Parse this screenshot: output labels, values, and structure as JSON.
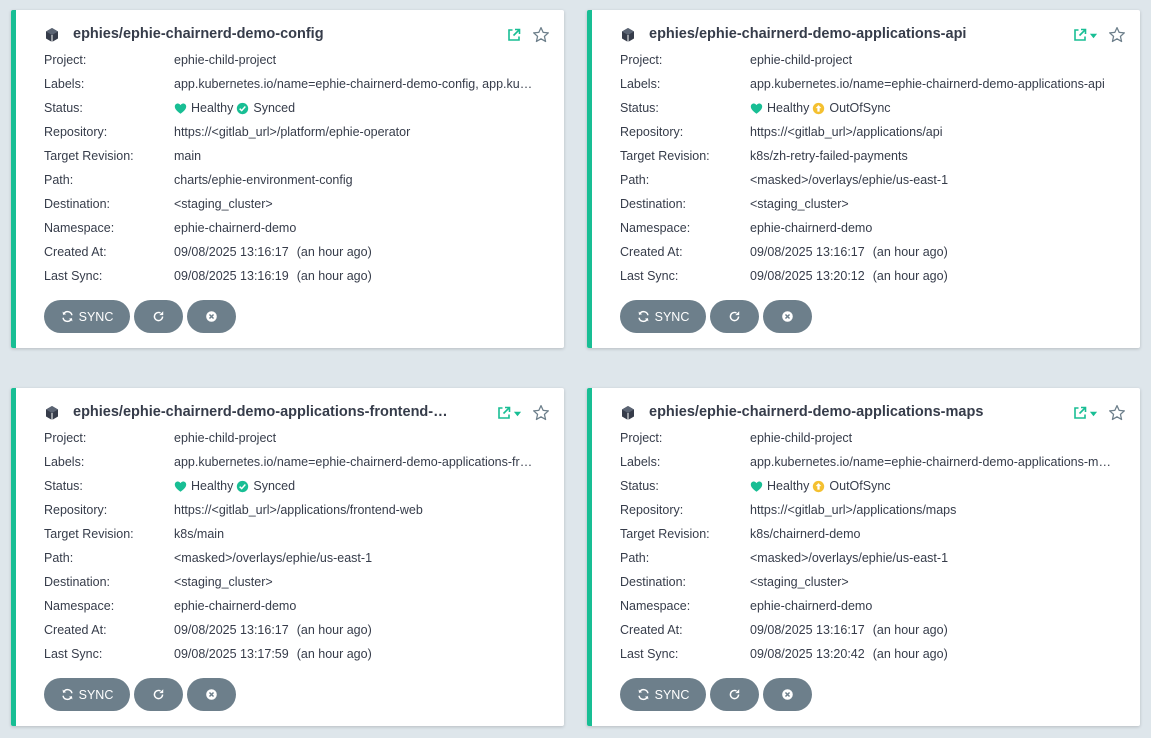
{
  "labels": {
    "project": "Project:",
    "labels": "Labels:",
    "status": "Status:",
    "repository": "Repository:",
    "target_revision": "Target Revision:",
    "path": "Path:",
    "destination": "Destination:",
    "namespace": "Namespace:",
    "created_at": "Created At:",
    "last_sync": "Last Sync:"
  },
  "buttons": {
    "sync_label": "SYNC"
  },
  "colors": {
    "healthy": "#18be94",
    "synced": "#18be94",
    "out_of_sync": "#f4c030",
    "card_border": "#18be94",
    "button_bg": "#6d7f8b"
  },
  "icons": {
    "app": "cube-icon",
    "external_link": "external-link-icon",
    "favorite": "star-icon",
    "healthy": "heart-icon",
    "synced": "check-circle-icon",
    "out_of_sync": "arrow-up-circle-icon",
    "sync": "sync-icon",
    "refresh": "redo-icon",
    "delete": "times-circle-icon"
  },
  "apps": [
    {
      "name": "ephies/ephie-chairnerd-demo-config",
      "project": "ephie-child-project",
      "labels": "app.kubernetes.io/name=ephie-chairnerd-demo-config, app.kubernetes.io/part-of=ephie",
      "health": "Healthy",
      "sync_status": "Synced",
      "repository": "https://<gitlab_url>/platform/ephie-operator",
      "target_revision": "main",
      "path": "charts/ephie-environment-config",
      "destination": "<staging_cluster>",
      "namespace": "ephie-chairnerd-demo",
      "created_at": "09/08/2025 13:16:17",
      "created_ago": "(an hour ago)",
      "last_sync": "09/08/2025 13:16:19",
      "last_sync_ago": "(an hour ago)"
    },
    {
      "name": "ephies/ephie-chairnerd-demo-applications-api",
      "project": "ephie-child-project",
      "labels": "app.kubernetes.io/name=ephie-chairnerd-demo-applications-api",
      "health": "Healthy",
      "sync_status": "OutOfSync",
      "repository": "https://<gitlab_url>/applications/api",
      "target_revision": "k8s/zh-retry-failed-payments",
      "path": "<masked>/overlays/ephie/us-east-1",
      "destination": "<staging_cluster>",
      "namespace": "ephie-chairnerd-demo",
      "created_at": "09/08/2025 13:16:17",
      "created_ago": "(an hour ago)",
      "last_sync": "09/08/2025 13:20:12",
      "last_sync_ago": "(an hour ago)"
    },
    {
      "name": "ephies/ephie-chairnerd-demo-applications-frontend-web",
      "project": "ephie-child-project",
      "labels": "app.kubernetes.io/name=ephie-chairnerd-demo-applications-frontend-web",
      "health": "Healthy",
      "sync_status": "Synced",
      "repository": "https://<gitlab_url>/applications/frontend-web",
      "target_revision": "k8s/main",
      "path": "<masked>/overlays/ephie/us-east-1",
      "destination": "<staging_cluster>",
      "namespace": "ephie-chairnerd-demo",
      "created_at": "09/08/2025 13:16:17",
      "created_ago": "(an hour ago)",
      "last_sync": "09/08/2025 13:17:59",
      "last_sync_ago": "(an hour ago)"
    },
    {
      "name": "ephies/ephie-chairnerd-demo-applications-maps",
      "project": "ephie-child-project",
      "labels": "app.kubernetes.io/name=ephie-chairnerd-demo-applications-maps",
      "health": "Healthy",
      "sync_status": "OutOfSync",
      "repository": "https://<gitlab_url>/applications/maps",
      "target_revision": "k8s/chairnerd-demo",
      "path": "<masked>/overlays/ephie/us-east-1",
      "destination": "<staging_cluster>",
      "namespace": "ephie-chairnerd-demo",
      "created_at": "09/08/2025 13:16:17",
      "created_ago": "(an hour ago)",
      "last_sync": "09/08/2025 13:20:42",
      "last_sync_ago": "(an hour ago)"
    }
  ]
}
